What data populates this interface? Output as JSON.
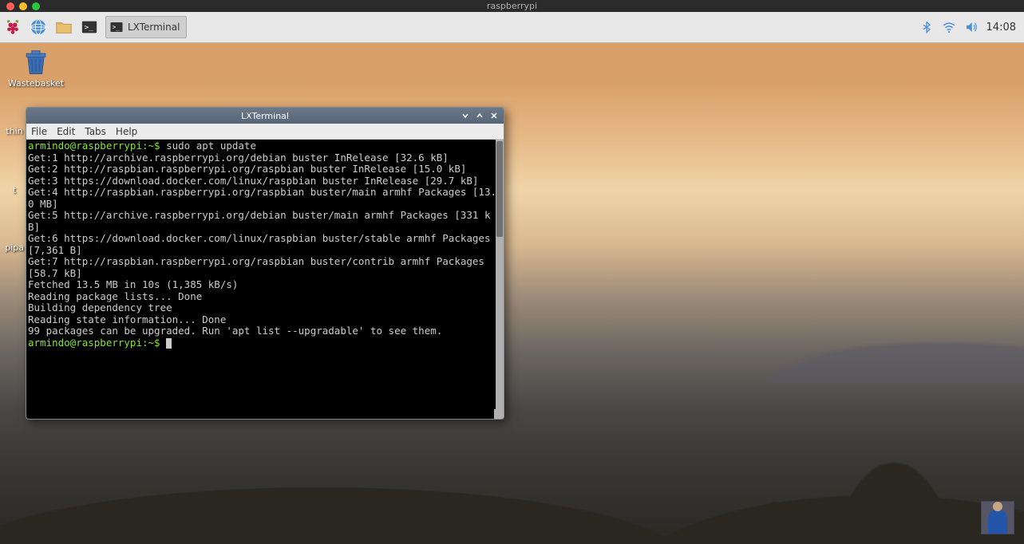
{
  "mac_titlebar": {
    "title": "raspberrypi"
  },
  "taskbar": {
    "app": {
      "label": "LXTerminal"
    },
    "clock": "14:08"
  },
  "desktop_icons": {
    "wastebasket": "Wastebasket",
    "partial1": "thin",
    "partial2": "t",
    "partial3": "pipa"
  },
  "terminal": {
    "window_title": "LXTerminal",
    "menu": {
      "file": "File",
      "edit": "Edit",
      "tabs": "Tabs",
      "help": "Help"
    },
    "prompt1": "armindo@raspberrypi:~$ ",
    "command1": "sudo apt update",
    "lines": [
      "Get:1 http://archive.raspberrypi.org/debian buster InRelease [32.6 kB]",
      "Get:2 http://raspbian.raspberrypi.org/raspbian buster InRelease [15.0 kB]",
      "Get:3 https://download.docker.com/linux/raspbian buster InRelease [29.7 kB]",
      "Get:4 http://raspbian.raspberrypi.org/raspbian buster/main armhf Packages [13.0 MB]",
      "Get:5 http://archive.raspberrypi.org/debian buster/main armhf Packages [331 kB]",
      "Get:6 https://download.docker.com/linux/raspbian buster/stable armhf Packages [7,361 B]",
      "Get:7 http://raspbian.raspberrypi.org/raspbian buster/contrib armhf Packages [58.7 kB]",
      "Fetched 13.5 MB in 10s (1,385 kB/s)",
      "Reading package lists... Done",
      "Building dependency tree",
      "Reading state information... Done",
      "99 packages can be upgraded. Run 'apt list --upgradable' to see them."
    ],
    "prompt2": "armindo@raspberrypi:~$ "
  }
}
